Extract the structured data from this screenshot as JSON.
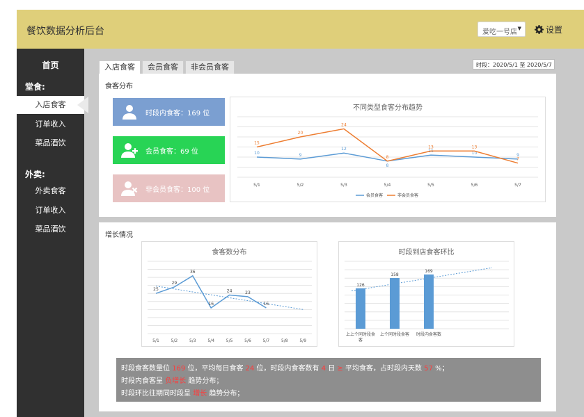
{
  "header": {
    "title": "餐饮数据分析后台",
    "store_select": "爱吃一号店",
    "settings_label": "设置"
  },
  "sidebar": {
    "home": "首页",
    "groups": [
      {
        "label": "堂食:",
        "items": [
          "入店食客",
          "订单收入",
          "菜品酒饮"
        ]
      },
      {
        "label": "外卖:",
        "items": [
          "外卖食客",
          "订单收入",
          "菜品酒饮"
        ]
      }
    ],
    "active_item": "入店食客"
  },
  "tabs": [
    {
      "label": "入店食客",
      "active": true
    },
    {
      "label": "会员食客",
      "active": false
    },
    {
      "label": "非会员食客",
      "active": false
    }
  ],
  "date_range": "时段：2020/5/1 至 2020/5/7",
  "panel1": {
    "title": "食客分布",
    "cards": [
      {
        "label": "时段内食客：169 位",
        "color": "#7b9fd1",
        "icon": "user-icon"
      },
      {
        "label": "会员食客：69 位",
        "color": "#28d455",
        "icon": "user-add-icon"
      },
      {
        "label": "非会员食客：100 位",
        "color": "#e8c3c3",
        "icon": "user-remove-icon"
      }
    ]
  },
  "panel2": {
    "title": "增长情况"
  },
  "summary": {
    "line1": [
      "时段食客数量位 ",
      "169",
      " 位，平均每日食客 ",
      "24",
      " 位，时段内食客数有 ",
      "4",
      " 日 ",
      "≥",
      " 平均食客，占时段内天数 ",
      "57",
      " %；"
    ],
    "line2": [
      "时段内食客呈 ",
      "负增长",
      " 趋势分布；"
    ],
    "line3": [
      "时段环比往期同时段呈 ",
      "增长",
      " 趋势分布；"
    ]
  },
  "chart_data": [
    {
      "type": "line",
      "title": "不同类型食客分布趋势",
      "categories": [
        "5/1",
        "5/2",
        "5/3",
        "5/4",
        "5/5",
        "5/6",
        "5/7"
      ],
      "series": [
        {
          "name": "会员食客",
          "color": "#5b9bd5",
          "values": [
            10,
            9,
            12,
            8,
            11,
            10,
            9
          ]
        },
        {
          "name": "非会员食客",
          "color": "#ed7d31",
          "values": [
            15,
            20,
            24,
            8,
            13,
            13,
            7
          ]
        }
      ],
      "ylim": [
        0,
        30
      ],
      "grid": true,
      "legend": "bottom"
    },
    {
      "type": "line",
      "title": "食客数分布",
      "categories": [
        "5/1",
        "5/2",
        "5/3",
        "5/4",
        "5/5",
        "5/6",
        "5/7",
        "5/8",
        "5/9"
      ],
      "series": [
        {
          "color": "#5b9bd5",
          "values": [
            25,
            29,
            36,
            16,
            24,
            23,
            16
          ]
        }
      ],
      "trendline": true,
      "ylim": [
        0,
        45
      ],
      "grid": true
    },
    {
      "type": "bar",
      "title": "时段到店食客环比",
      "categories": [
        "上上个同时段食客",
        "上个同时段食客",
        "时段内食客数"
      ],
      "values": [
        126,
        158,
        169
      ],
      "color": "#5b9bd5",
      "trendline": true,
      "ylim": [
        0,
        210
      ],
      "grid": true
    }
  ]
}
